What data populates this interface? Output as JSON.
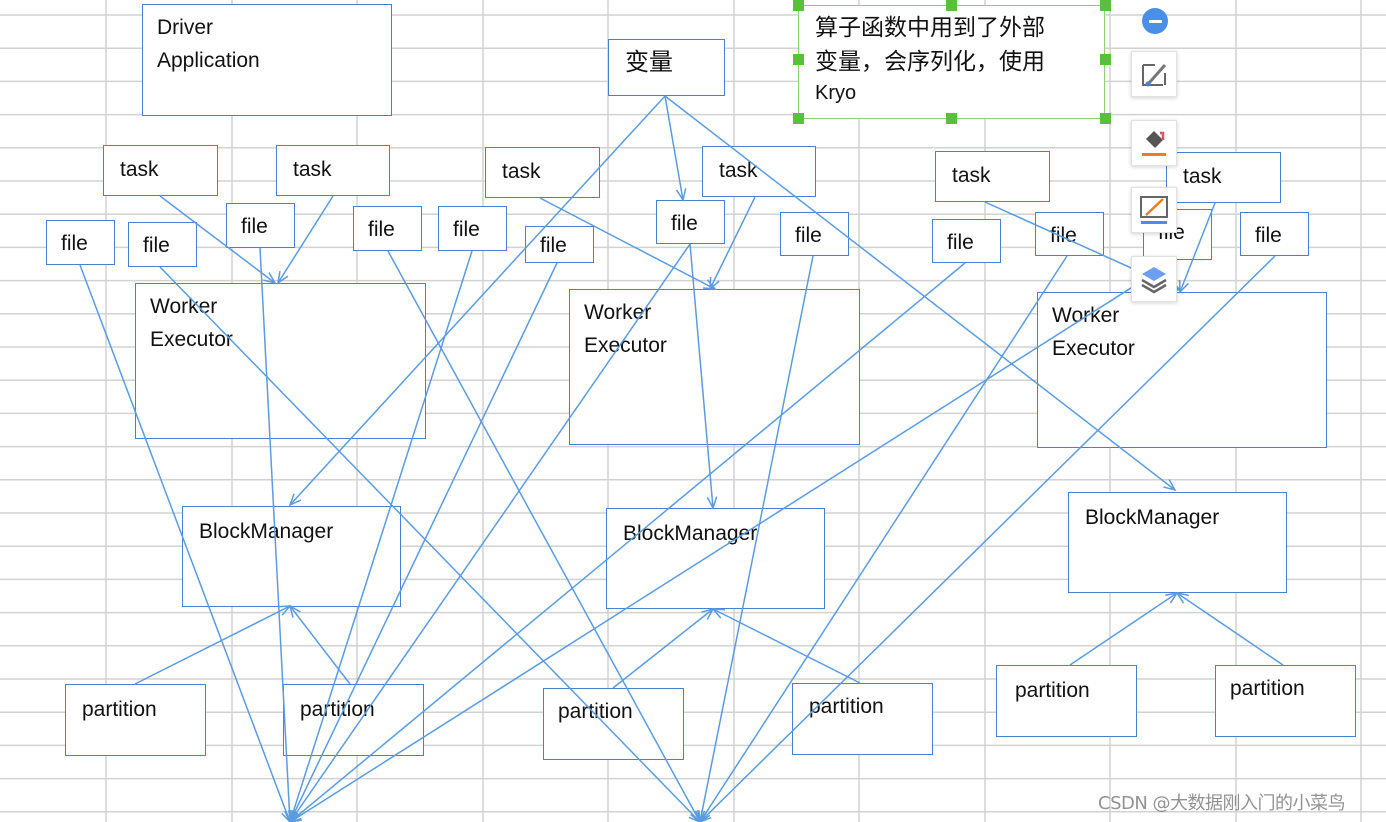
{
  "diagram": {
    "driver": {
      "label": "Driver\nApplication"
    },
    "variable": {
      "label": "变量"
    },
    "note": {
      "line1": "算子函数中用到了外部",
      "line2": "变量，会序列化，使用",
      "line3": "Kryo"
    },
    "workers": [
      {
        "executor_label": "Worker\nExecutor",
        "blockmanager_label": "BlockManager",
        "tasks": [
          "task",
          "task"
        ],
        "files": [
          "file",
          "file",
          "file",
          "file",
          "file"
        ],
        "partitions": [
          "partition",
          "partition"
        ]
      },
      {
        "executor_label": "Worker\nExecutor",
        "blockmanager_label": "BlockManager",
        "tasks": [
          "task",
          "task"
        ],
        "files": [
          "file",
          "file",
          "file"
        ],
        "partitions": [
          "partition",
          "partition"
        ]
      },
      {
        "executor_label": "Worker\nExecutor",
        "blockmanager_label": "BlockManager",
        "tasks": [
          "task",
          "task"
        ],
        "files": [
          "file",
          "file",
          "file",
          "file"
        ],
        "partitions": [
          "partition",
          "partition"
        ]
      }
    ],
    "edge_color": "#5b9be0",
    "node_border_color": "#4a7fd1"
  },
  "toolbar": {
    "collapse_icon": "minus-circle-icon",
    "items": [
      {
        "name": "edit-shape-icon"
      },
      {
        "name": "fill-color-icon"
      },
      {
        "name": "line-color-icon"
      },
      {
        "name": "layers-icon"
      }
    ]
  },
  "watermark": "CSDN @大数据刚入门的小菜鸟"
}
